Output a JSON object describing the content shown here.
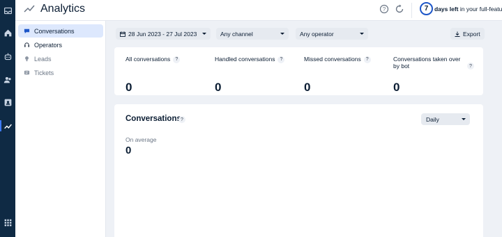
{
  "app": {
    "title": "Analytics"
  },
  "header": {
    "trial_days": "7",
    "trial_bold": "days left",
    "trial_rest": " in your full-feature"
  },
  "subnav": [
    {
      "label": "Conversations",
      "icon": "chat-bubble-icon"
    },
    {
      "label": "Operators",
      "icon": "headset-icon"
    },
    {
      "label": "Leads",
      "icon": "lightbulb-icon"
    },
    {
      "label": "Tickets",
      "icon": "ticket-icon"
    }
  ],
  "filters": {
    "date_range": "28 Jun 2023 - 27 Jul 2023",
    "channel": "Any channel",
    "operator": "Any operator",
    "export_label": "Export"
  },
  "stats": [
    {
      "label": "All conversations",
      "value": "0"
    },
    {
      "label": "Handled conversations",
      "value": "0"
    },
    {
      "label": "Missed conversations",
      "value": "0"
    },
    {
      "label": "Conversations taken over by bot",
      "value": "0"
    }
  ],
  "conversations_panel": {
    "title": "Conversations",
    "interval": "Daily",
    "average_label": "On average",
    "average_value": "0"
  },
  "help_mark": "?",
  "colors": {
    "rail": "#0f2a44",
    "accent": "#3e7bfa",
    "active_nav_bg": "#dde8fd",
    "page_bg": "#eef1f6"
  }
}
